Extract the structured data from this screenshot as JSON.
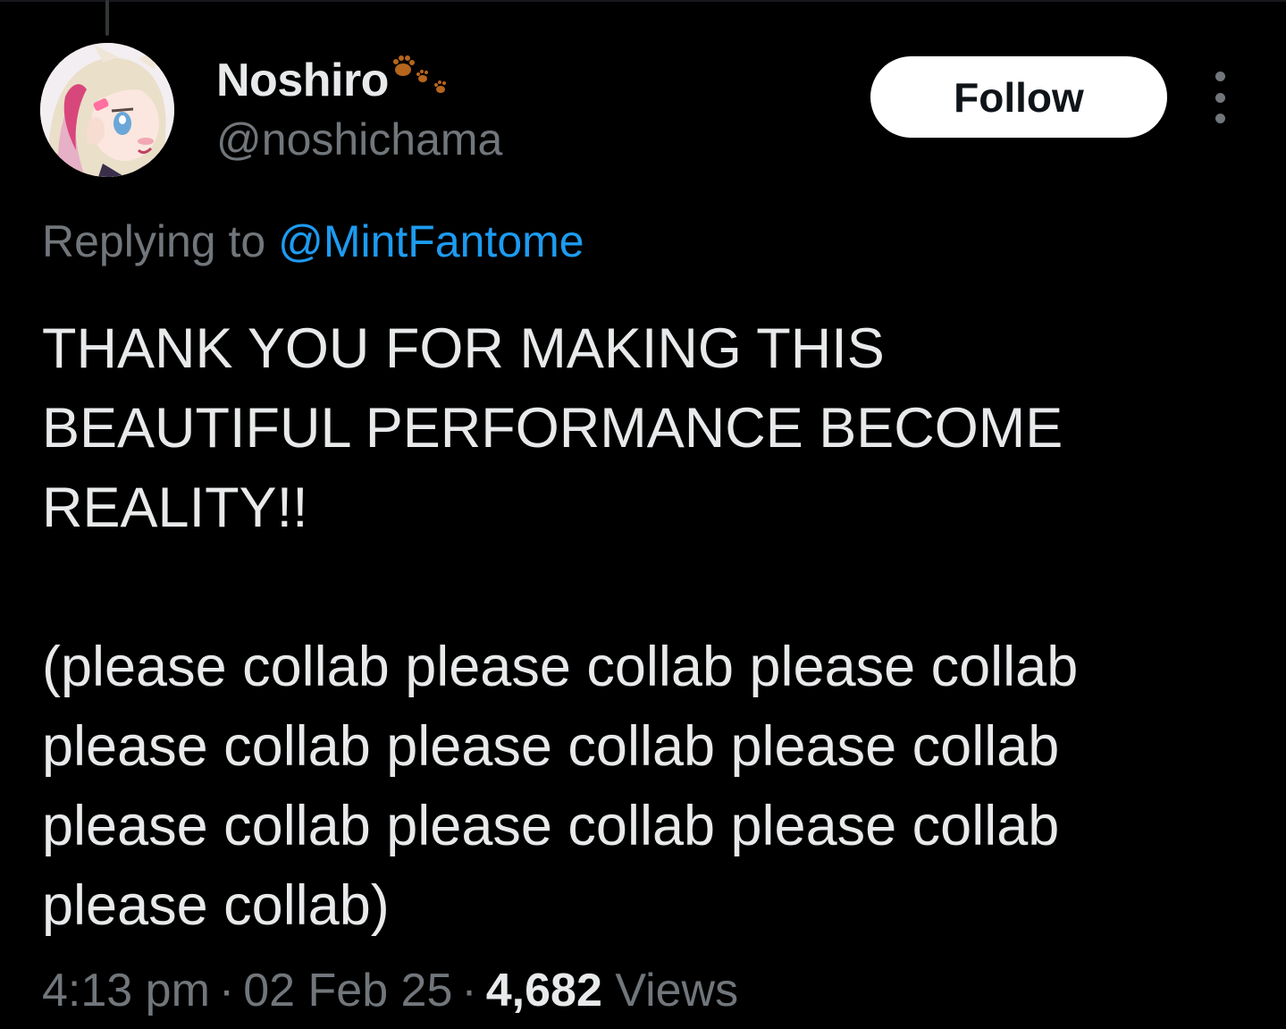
{
  "tweet": {
    "author": {
      "display_name": "Noshiro",
      "handle": "@noshichama",
      "name_emoji_icon": "paw-prints-icon",
      "avatar_icon": "anime-girl-avatar"
    },
    "follow_label": "Follow",
    "more_icon": "more-vertical-icon",
    "replying_prefix": "Replying to",
    "replying_to": "@MintFantome",
    "text": "THANK YOU FOR MAKING THIS\nBEAUTIFUL PERFORMANCE BECOME\nREALITY!!\n\n(please collab please collab please collab\nplease collab please collab please collab\nplease collab please collab please collab\nplease collab)",
    "time": "4:13 pm",
    "date": "02 Feb 25",
    "separator": "·",
    "views_count": "4,682",
    "views_label": "Views"
  },
  "colors": {
    "background": "#000000",
    "primary_text": "#e7e9ea",
    "secondary_text": "#71767b",
    "link": "#1d9bf0",
    "follow_bg": "#ffffff",
    "paw": "#b5651d"
  }
}
